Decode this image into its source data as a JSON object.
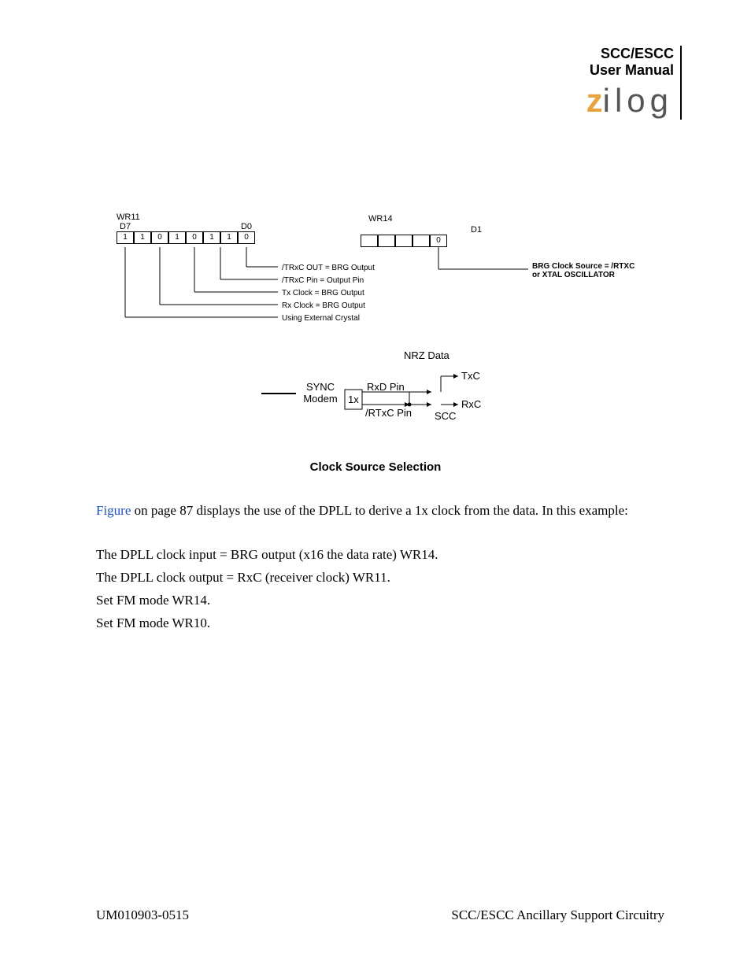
{
  "header": {
    "line1": "SCC/ESCC",
    "line2": "User Manual"
  },
  "logo": {
    "accentLetter": "z",
    "rest": "ilog"
  },
  "wr11": {
    "title": "WR11",
    "msb": "D7",
    "lsb": "D0",
    "bits": [
      "1",
      "1",
      "0",
      "1",
      "0",
      "1",
      "1",
      "0"
    ],
    "notes": [
      "/TRxC  OUT = BRG Output",
      "/TRxC  Pin = Output Pin",
      "Tx Clock = BRG Output",
      "Rx Clock = BRG Output",
      "Using External Crystal"
    ]
  },
  "wr14": {
    "title": "WR14",
    "lsb": "D1",
    "bits": [
      "",
      "",
      "",
      "",
      "0"
    ],
    "note": "BRG Clock Source = /RTXC or XTAL OSCILLATOR"
  },
  "block": {
    "nrz": "NRZ Data",
    "modemL1": "SYNC",
    "modemL2": "Modem",
    "one_x": "1x",
    "rxd": "RxD Pin",
    "rtxc": "/RTxC Pin",
    "txc": "TxC",
    "rxc": "RxC",
    "scc": "SCC"
  },
  "figureCaption": "Clock Source Selection",
  "body": {
    "refWord": "Figure",
    "refRest": "  on page 87 displays the use of the DPLL to derive a 1x clock from the data. In this example:",
    "line2": "The DPLL clock input = BRG output (x16 the data rate) WR14.",
    "line3": "The DPLL clock output = RxC (receiver clock) WR11.",
    "line4": "Set FM mode WR14.",
    "line5": "Set FM mode WR10."
  },
  "footer": {
    "left": "UM010903-0515",
    "right": "SCC/ESCC Ancillary Support Circuitry"
  }
}
